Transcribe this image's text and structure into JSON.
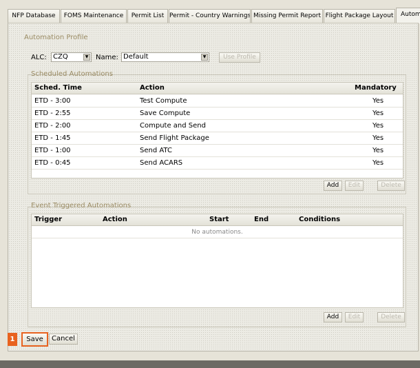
{
  "tabs": [
    {
      "label": "NFP Database",
      "active": false
    },
    {
      "label": "FOMS Maintenance",
      "active": false
    },
    {
      "label": "Permit List",
      "active": false
    },
    {
      "label": "Permit - Country Warnings",
      "active": false
    },
    {
      "label": "Missing Permit Report",
      "active": false
    },
    {
      "label": "Flight Package Layout",
      "active": false
    },
    {
      "label": "Autom",
      "active": true
    }
  ],
  "automation_profile": {
    "title": "Automation Profile",
    "alc_label": "ALC:",
    "alc_value": "CZQ",
    "name_label": "Name:",
    "name_value": "Default",
    "use_profile_label": "Use Profile"
  },
  "scheduled": {
    "title": "Scheduled Automations",
    "headers": {
      "time": "Sched. Time",
      "action": "Action",
      "mandatory": "Mandatory"
    },
    "rows": [
      {
        "time": "ETD - 3:00",
        "action": "Test Compute",
        "mandatory": "Yes"
      },
      {
        "time": "ETD - 2:55",
        "action": "Save Compute",
        "mandatory": "Yes"
      },
      {
        "time": "ETD - 2:00",
        "action": "Compute and Send",
        "mandatory": "Yes"
      },
      {
        "time": "ETD - 1:45",
        "action": "Send Flight Package",
        "mandatory": "Yes"
      },
      {
        "time": "ETD - 1:00",
        "action": "Send ATC",
        "mandatory": "Yes"
      },
      {
        "time": "ETD - 0:45",
        "action": "Send ACARS",
        "mandatory": "Yes"
      }
    ],
    "add_label": "Add",
    "edit_label": "Edit",
    "delete_label": "Delete"
  },
  "event": {
    "title": "Event Triggered Automations",
    "headers": {
      "trigger": "Trigger",
      "action": "Action",
      "start": "Start",
      "end": "End",
      "conditions": "Conditions"
    },
    "empty_text": "No automations.",
    "add_label": "Add",
    "edit_label": "Edit",
    "delete_label": "Delete"
  },
  "footer": {
    "step_marker": "1",
    "save_label": "Save",
    "cancel_label": "Cancel"
  },
  "colors": {
    "accent": "#e8621f",
    "legend": "#9a8b63"
  }
}
